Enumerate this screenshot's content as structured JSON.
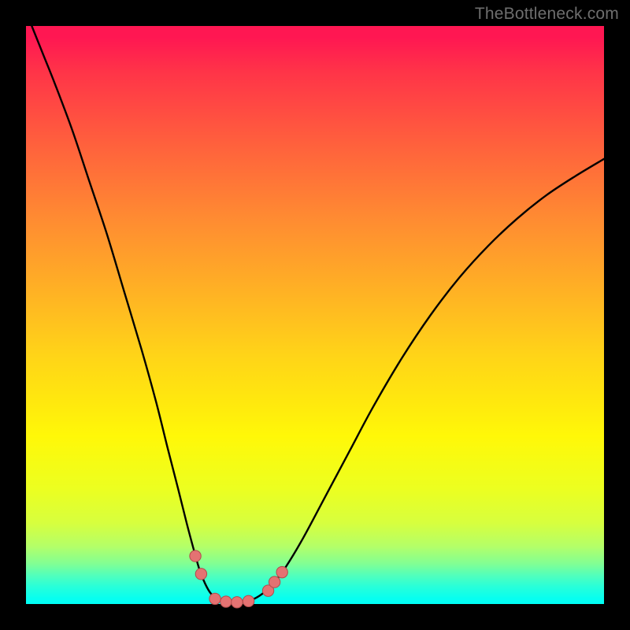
{
  "watermark": "TheBottleneck.com",
  "colors": {
    "frame": "#000000",
    "gradient_top": "#ff1752",
    "gradient_bottom": "#00fff6",
    "curve_stroke": "#000000",
    "marker_fill": "#e47272",
    "marker_stroke": "#b24b4b"
  },
  "chart_data": {
    "type": "line",
    "title": "",
    "xlabel": "",
    "ylabel": "",
    "xlim": [
      0,
      1
    ],
    "ylim": [
      0,
      1
    ],
    "curve": [
      {
        "x": 0.01,
        "y": 1.0
      },
      {
        "x": 0.03,
        "y": 0.95
      },
      {
        "x": 0.05,
        "y": 0.9
      },
      {
        "x": 0.08,
        "y": 0.82
      },
      {
        "x": 0.11,
        "y": 0.73
      },
      {
        "x": 0.14,
        "y": 0.64
      },
      {
        "x": 0.17,
        "y": 0.54
      },
      {
        "x": 0.2,
        "y": 0.44
      },
      {
        "x": 0.225,
        "y": 0.35
      },
      {
        "x": 0.245,
        "y": 0.27
      },
      {
        "x": 0.263,
        "y": 0.2
      },
      {
        "x": 0.278,
        "y": 0.14
      },
      {
        "x": 0.29,
        "y": 0.095
      },
      {
        "x": 0.3,
        "y": 0.06
      },
      {
        "x": 0.31,
        "y": 0.035
      },
      {
        "x": 0.32,
        "y": 0.018
      },
      {
        "x": 0.333,
        "y": 0.008
      },
      {
        "x": 0.35,
        "y": 0.003
      },
      {
        "x": 0.37,
        "y": 0.003
      },
      {
        "x": 0.39,
        "y": 0.007
      },
      {
        "x": 0.408,
        "y": 0.017
      },
      {
        "x": 0.426,
        "y": 0.033
      },
      {
        "x": 0.45,
        "y": 0.065
      },
      {
        "x": 0.48,
        "y": 0.115
      },
      {
        "x": 0.52,
        "y": 0.19
      },
      {
        "x": 0.56,
        "y": 0.265
      },
      {
        "x": 0.6,
        "y": 0.34
      },
      {
        "x": 0.65,
        "y": 0.425
      },
      {
        "x": 0.7,
        "y": 0.5
      },
      {
        "x": 0.75,
        "y": 0.565
      },
      {
        "x": 0.8,
        "y": 0.62
      },
      {
        "x": 0.85,
        "y": 0.667
      },
      {
        "x": 0.9,
        "y": 0.707
      },
      {
        "x": 0.95,
        "y": 0.74
      },
      {
        "x": 1.0,
        "y": 0.77
      }
    ],
    "markers": [
      {
        "x": 0.293,
        "y": 0.083
      },
      {
        "x": 0.303,
        "y": 0.052
      },
      {
        "x": 0.327,
        "y": 0.009
      },
      {
        "x": 0.346,
        "y": 0.004
      },
      {
        "x": 0.365,
        "y": 0.003
      },
      {
        "x": 0.385,
        "y": 0.005
      },
      {
        "x": 0.419,
        "y": 0.023
      },
      {
        "x": 0.43,
        "y": 0.038
      },
      {
        "x": 0.443,
        "y": 0.055
      }
    ]
  }
}
